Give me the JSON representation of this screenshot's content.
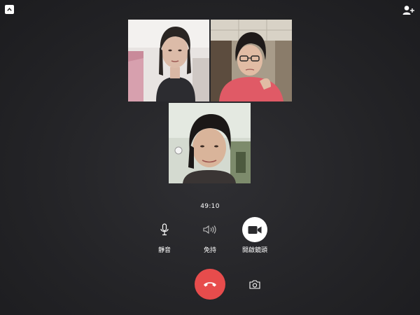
{
  "call": {
    "timer": "49:10"
  },
  "topbar": {
    "collapse_icon": "chevron-up-icon",
    "add_person_icon": "add-person-icon"
  },
  "participants": [
    {
      "tile": "participant-video-1"
    },
    {
      "tile": "participant-video-2"
    },
    {
      "tile": "participant-video-3"
    }
  ],
  "controls": {
    "mute": {
      "label": "靜音",
      "icon": "microphone-icon"
    },
    "speaker": {
      "label": "免持",
      "icon": "speaker-icon"
    },
    "camera": {
      "label": "開啟鏡頭",
      "icon": "video-camera-icon"
    },
    "end_call": {
      "icon": "hang-up-icon",
      "color": "#e74c4c"
    },
    "switch_camera": {
      "icon": "switch-camera-icon"
    }
  }
}
